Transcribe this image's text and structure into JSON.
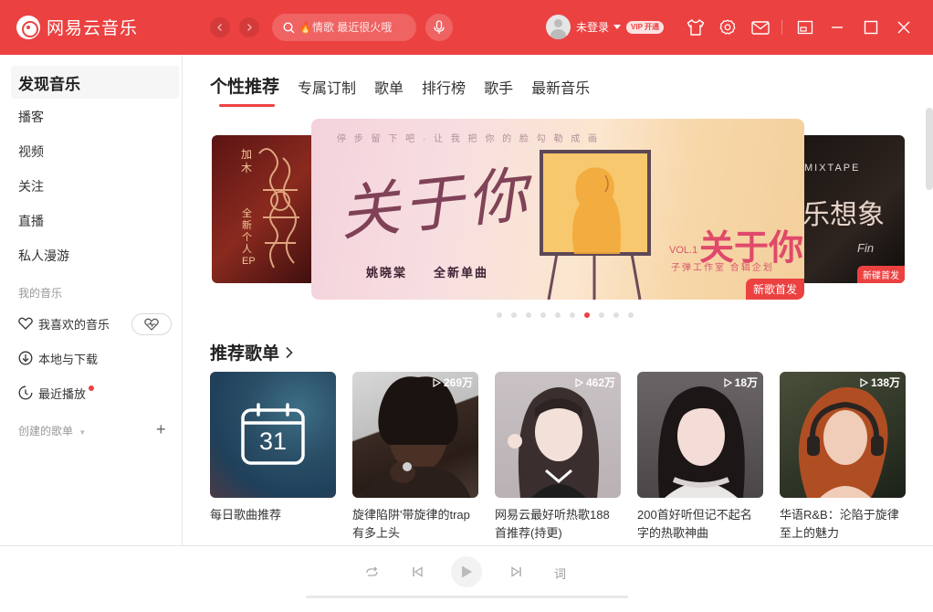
{
  "app": {
    "title": "网易云音乐"
  },
  "titlebar": {
    "search_placeholder": "🔥情歌 最近很火哦",
    "user_name": "未登录",
    "vip_label": "VIP 开通",
    "icons": [
      "back-icon",
      "forward-icon",
      "search-icon",
      "mic-icon",
      "skin-icon",
      "settings-icon",
      "mail-icon",
      "mini-mode-icon",
      "minimize-icon",
      "maximize-icon",
      "close-icon"
    ]
  },
  "sidebar": {
    "items": [
      {
        "label": "发现音乐"
      },
      {
        "label": "播客"
      },
      {
        "label": "视频"
      },
      {
        "label": "关注"
      },
      {
        "label": "直播"
      },
      {
        "label": "私人漫游"
      }
    ],
    "my_music_label": "我的音乐",
    "my_music": [
      {
        "label": "我喜欢的音乐",
        "icon": "heart-icon"
      },
      {
        "label": "本地与下载",
        "icon": "download-icon"
      },
      {
        "label": "最近播放",
        "icon": "history-icon"
      }
    ],
    "created_playlists_label": "创建的歌单"
  },
  "tabs": [
    "个性推荐",
    "专属订制",
    "歌单",
    "排行榜",
    "歌手",
    "最新音乐"
  ],
  "banner": {
    "main": {
      "top_text": "停 步 留 下 吧 · 让 我 把 你 的 脸 勾 勒 成 画",
      "calligraphy": "关于你",
      "artist": "姚晓棠",
      "subtitle": "全新单曲",
      "logo_title": "关于你",
      "vol": "VOL.1",
      "studio": "子弹工作室 合辑企划",
      "badge": "新歌首发"
    },
    "left": {
      "title": "全新个人EP",
      "artist": "加木"
    },
    "right": {
      "title": "MIXTAPE",
      "chars": "乐想象",
      "sub": "Fin",
      "badge": "新碟首发"
    },
    "dot_count": 10,
    "active_dot": 6
  },
  "section": {
    "title": "推荐歌单"
  },
  "playlists": [
    {
      "title": "每日歌曲推荐",
      "count": "",
      "calendar_day": "31"
    },
    {
      "title": "旋律陷阱'带旋律的trap有多上头",
      "count": "269万"
    },
    {
      "title": "网易云最好听热歌188首推荐(持更)",
      "count": "462万"
    },
    {
      "title": "200首好听但记不起名字的热歌神曲",
      "count": "18万"
    },
    {
      "title": "华语R&B：沦陷于旋律至上的魅力",
      "count": "138万"
    }
  ],
  "player": {
    "lyric_label": "词"
  }
}
